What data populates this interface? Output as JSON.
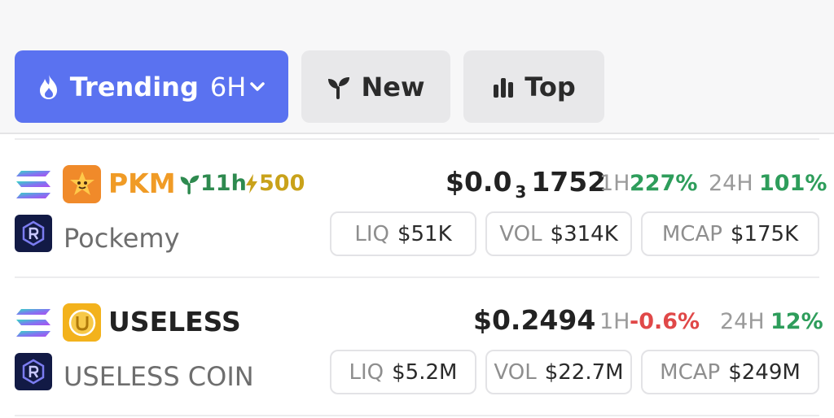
{
  "tabs": {
    "trending": {
      "label": "Trending",
      "period": "6H",
      "icon": "flame-icon"
    },
    "new": {
      "label": "New",
      "icon": "sprout-icon"
    },
    "top": {
      "label": "Top",
      "icon": "bar-chart-icon"
    }
  },
  "colors": {
    "accent": "#5a72f0",
    "positive": "#2e9d5b",
    "negative": "#e04848",
    "age": "#2e8a4f",
    "boost": "#c9a21a"
  },
  "tokens": [
    {
      "symbol": "PKM",
      "name": "Pockemy",
      "age": "11h",
      "boost": "500",
      "price_prefix": "$0.0",
      "price_zeros": "3",
      "price_rest": "1752",
      "h1_label": "1H",
      "h1_change": "227%",
      "h24_label": "24H",
      "h24_change": "101%",
      "liq_label": "LIQ",
      "liq": "$51K",
      "vol_label": "VOL",
      "vol": "$314K",
      "mcap_label": "MCAP",
      "mcap": "$175K",
      "chain_icon": "solana-icon",
      "dex_icon": "raydium-icon",
      "logo_icon": "pkm-logo-icon"
    },
    {
      "symbol": "USELESS",
      "name": "USELESS COIN",
      "price": "$0.2494",
      "h1_label": "1H",
      "h1_change": "-0.6%",
      "h24_label": "24H",
      "h24_change": "12%",
      "liq_label": "LIQ",
      "liq": "$5.2M",
      "vol_label": "VOL",
      "vol": "$22.7M",
      "mcap_label": "MCAP",
      "mcap": "$249M",
      "chain_icon": "solana-icon",
      "dex_icon": "raydium-icon",
      "logo_icon": "useless-logo-icon"
    }
  ]
}
